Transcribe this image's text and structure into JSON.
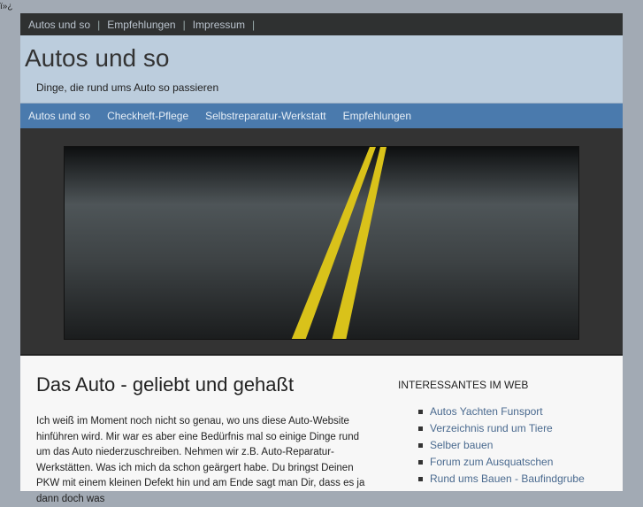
{
  "bom": "ï»¿",
  "topbar": {
    "links": [
      "Autos und so",
      "Empfehlungen",
      "Impressum"
    ],
    "separator": "|"
  },
  "header": {
    "title": "Autos und so",
    "tagline": "Dinge, die rund ums Auto so passieren"
  },
  "nav": {
    "items": [
      "Autos und so",
      "Checkheft-Pflege",
      "Selbstreparatur-Werkstatt",
      "Empfehlungen"
    ]
  },
  "post": {
    "title": "Das Auto - geliebt und gehaßt",
    "body": "Ich weiß im Moment noch nicht so genau, wo uns diese Auto-Website hinführen wird. Mir war es aber eine Bedürfnis mal so einige Dinge rund um das Auto niederzuschreiben. Nehmen wir z.B. Auto-Reparatur-Werkstätten. Was ich mich da schon geärgert habe. Du bringst Deinen PKW mit einem kleinen Defekt hin und am Ende sagt man Dir, dass es ja dann doch was"
  },
  "sidebar": {
    "heading": "INTERESSANTES IM WEB",
    "links": [
      "Autos Yachten Funsport",
      "Verzeichnis rund um Tiere",
      "Selber bauen",
      "Forum zum Ausquatschen",
      "Rund ums Bauen - Baufindgrube"
    ]
  }
}
